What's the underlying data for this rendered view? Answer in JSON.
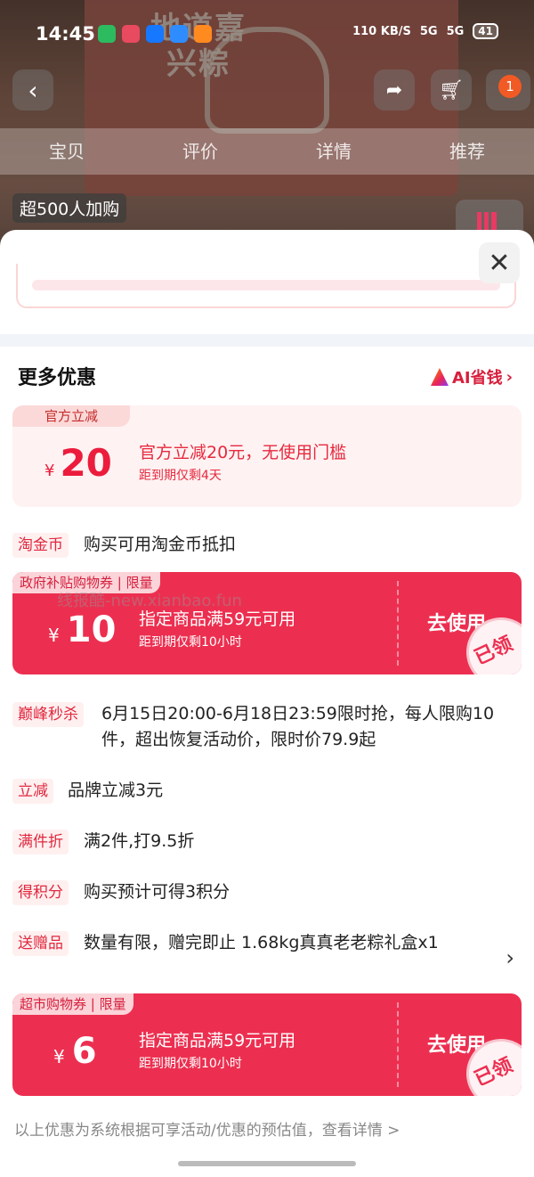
{
  "status_bar": {
    "time": "14:45",
    "network_speed": "110 KB/S",
    "signal_1": "5G",
    "signal_2": "5G",
    "battery": "41"
  },
  "background": {
    "banner_text": "地道嘉兴粽",
    "cart_badge": "1",
    "tabs": [
      "宝贝",
      "评价",
      "详情",
      "推荐"
    ],
    "promo_pill": "超500人加购"
  },
  "sheet": {
    "title": "更多优惠",
    "ai_link": "AI省钱",
    "official": {
      "tag": "官方立减",
      "currency": "¥",
      "amount": "20",
      "desc": "官方立减20元，无使用门槛",
      "sub": "距到期仅剩4天"
    },
    "taojinbi": {
      "tag": "淘金币",
      "text": "购买可用淘金币抵扣"
    },
    "coupon_gov": {
      "tag": "政府补贴购物券 | 限量",
      "currency": "¥",
      "amount": "10",
      "desc": "指定商品满59元可用",
      "sub": "距到期仅剩10小时",
      "action": "去使用",
      "stamp": "已领"
    },
    "peak": {
      "tag": "巅峰秒杀",
      "text": "6月15日20:00-6月18日23:59限时抢，每人限购10件，超出恢复活动价，限时价79.9起"
    },
    "reduce": {
      "tag": "立减",
      "text": "品牌立减3元"
    },
    "discount": {
      "tag": "满件折",
      "text": "满2件,打9.5折"
    },
    "points": {
      "tag": "得积分",
      "text": "购买预计可得3积分"
    },
    "gift": {
      "tag": "送赠品",
      "text": "数量有限，赠完即止 1.68kg真真老老粽礼盒x1"
    },
    "coupon_market": {
      "tag": "超市购物券 | 限量",
      "currency": "¥",
      "amount": "6",
      "desc": "指定商品满59元可用",
      "sub": "距到期仅剩10小时",
      "action": "去使用",
      "stamp": "已领"
    },
    "footer": "以上优惠为系统根据可享活动/优惠的预估值，查看详情 >"
  },
  "watermark": "线报酷-new.xianbao.fun"
}
